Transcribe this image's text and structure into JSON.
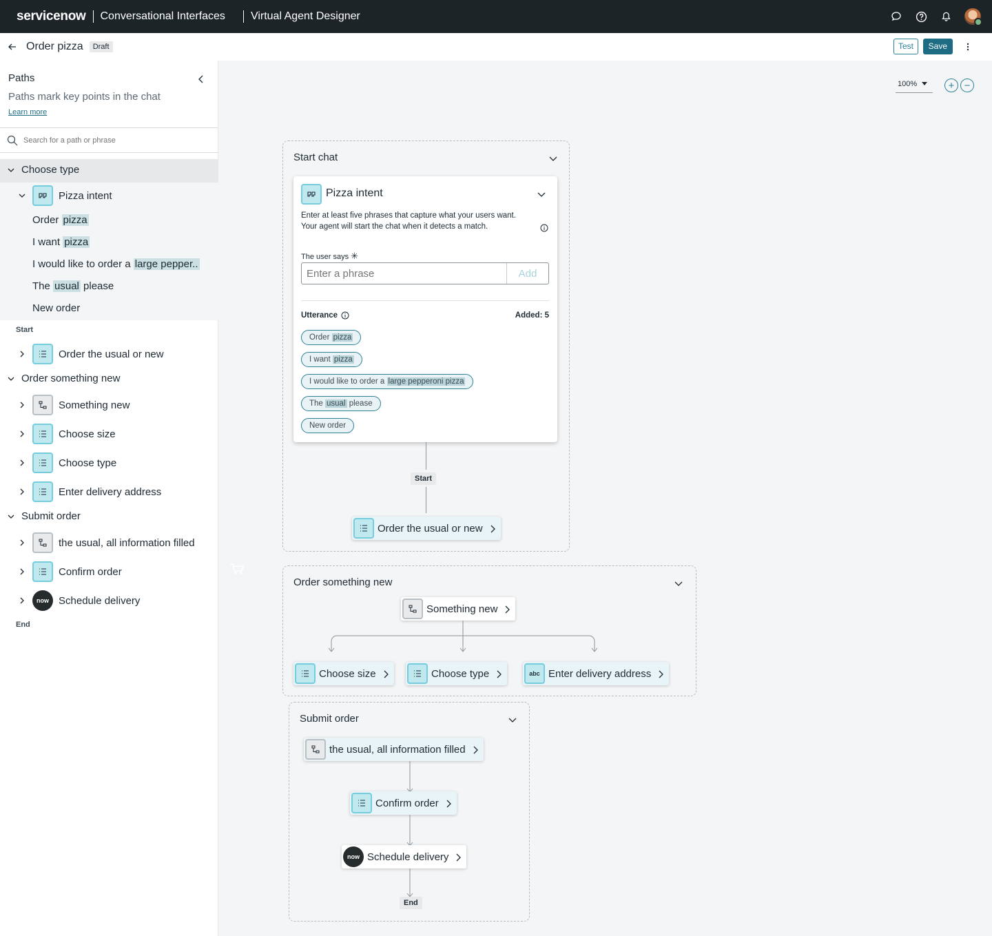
{
  "topbar": {
    "logo": "servicenow",
    "app": "Conversational Interfaces",
    "module": "Virtual Agent Designer",
    "icons": [
      "chat-icon",
      "help-icon",
      "bell-icon",
      "avatar"
    ]
  },
  "subbar": {
    "title": "Order pizza",
    "status": "Draft",
    "test_label": "Test",
    "save_label": "Save"
  },
  "sidebar": {
    "heading": "Paths",
    "description": "Paths mark key points in the chat",
    "learn_more": "Learn more",
    "search_placeholder": "Search for a path or phrase",
    "choose_type_group": "Choose type",
    "pizza_intent": "Pizza intent",
    "phrases": [
      {
        "pre": "Order ",
        "hl": "pizza",
        "post": ""
      },
      {
        "pre": "I want ",
        "hl": "pizza",
        "post": ""
      },
      {
        "pre": "I would like to order a ",
        "hl": "large pepper..",
        "post": ""
      },
      {
        "pre": "The ",
        "hl": "usual",
        "post": " please"
      },
      {
        "pre": "New order",
        "hl": "",
        "post": ""
      }
    ],
    "start_label": "Start",
    "order_usual": "Order the usual or new",
    "order_new_group": "Order something new",
    "something_new": "Something new",
    "choose_size": "Choose size",
    "choose_type": "Choose type",
    "delivery_address": "Enter delivery address",
    "submit_group": "Submit order",
    "usual_filled": "the usual, all information filled",
    "confirm_order": "Confirm order",
    "schedule_delivery": "Schedule delivery",
    "end_label": "End",
    "now_badge": "now"
  },
  "canvas": {
    "zoom": "100%",
    "zoom_in": "+",
    "zoom_out": "−",
    "start_chat": {
      "title": "Start chat",
      "intent_title": "Pizza intent",
      "intent_desc_1": "Enter at least five phrases that capture what your users want.",
      "intent_desc_2": "Your agent will start the chat when it detects a match.",
      "user_says_label": "The user says",
      "phrase_placeholder": "Enter a phrase",
      "add_label": "Add",
      "utterance_label": "Utterance",
      "added_count": "Added: 5",
      "utterances": [
        {
          "pre": "Order ",
          "hl": "pizza",
          "post": ""
        },
        {
          "pre": "I want ",
          "hl": "pizza",
          "post": ""
        },
        {
          "pre": "I would like to order a ",
          "hl": "large pepperoni pizza",
          "post": ""
        },
        {
          "pre": "The ",
          "hl": "usual",
          "post": " please"
        },
        {
          "pre": "New order",
          "hl": "",
          "post": ""
        }
      ],
      "start_tag": "Start",
      "next_node": "Order the usual or new"
    },
    "order_new": {
      "title": "Order something new",
      "root": "Something new",
      "children": [
        "Choose size",
        "Choose type",
        "Enter delivery address"
      ],
      "abc": "abc"
    },
    "submit": {
      "title": "Submit order",
      "nodes": [
        "the usual, all information filled",
        "Confirm order",
        "Schedule delivery"
      ],
      "end_tag": "End",
      "now_badge": "now"
    }
  },
  "colors": {
    "accent": "#2b8198",
    "save_bg": "#1e6c83",
    "topbar": "#1d2428",
    "node_icon_bg": "#bfe8ef"
  }
}
